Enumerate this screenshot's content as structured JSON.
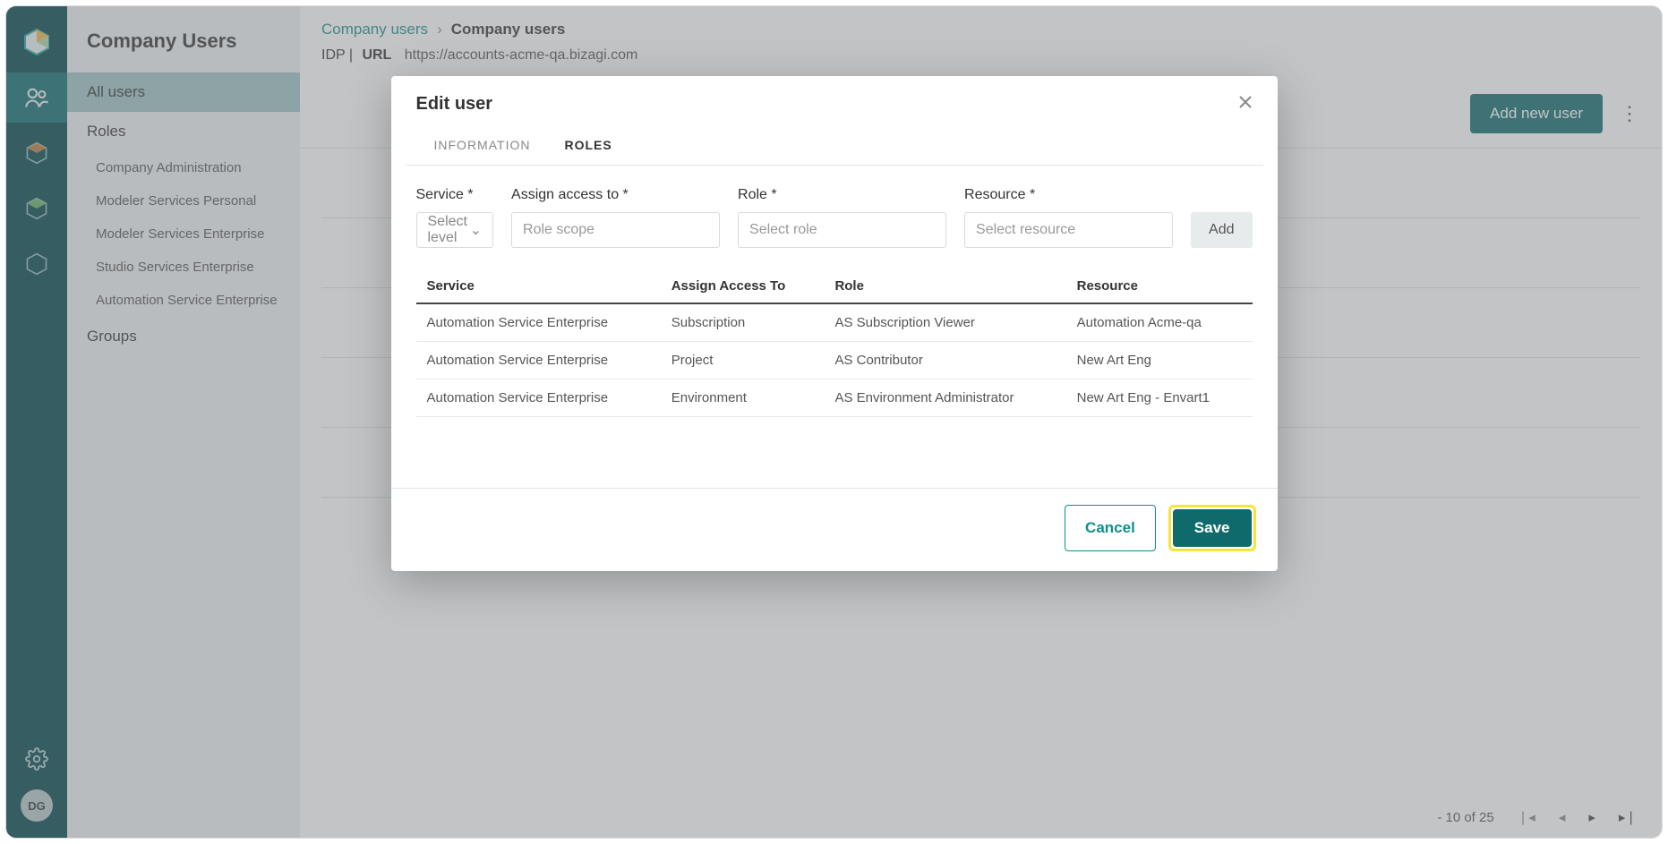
{
  "rail": {
    "avatar_initials": "DG"
  },
  "sidebar": {
    "title": "Company Users",
    "items": [
      {
        "label": "All users",
        "active": true
      },
      {
        "label": "Roles",
        "active": false
      }
    ],
    "role_children": [
      "Company Administration",
      "Modeler Services Personal",
      "Modeler Services Enterprise",
      "Studio Services Enterprise",
      "Automation Service Enterprise"
    ],
    "groups_label": "Groups"
  },
  "breadcrumb": {
    "link": "Company users",
    "current": "Company users"
  },
  "idp": {
    "prefix": "IDP |",
    "url_label": "URL",
    "url_value": "https://accounts-acme-qa.bizagi.com"
  },
  "toolbar": {
    "add_user": "Add new user"
  },
  "pager": {
    "range": "- 10 of 25"
  },
  "modal": {
    "title": "Edit user",
    "tabs": {
      "information": "Information",
      "roles": "Roles"
    },
    "filters": {
      "service_label": "Service *",
      "service_placeholder": "Select level",
      "assign_label": "Assign access to *",
      "assign_placeholder": "Role scope",
      "role_label": "Role *",
      "role_placeholder": "Select role",
      "resource_label": "Resource *",
      "resource_placeholder": "Select resource",
      "add_button": "Add"
    },
    "table": {
      "headers": {
        "service": "Service",
        "assign": "Assign Access To",
        "role": "Role",
        "resource": "Resource"
      },
      "rows": [
        {
          "service": "Automation Service Enterprise",
          "assign": "Subscription",
          "role": "AS Subscription Viewer",
          "resource": "Automation Acme-qa"
        },
        {
          "service": "Automation Service Enterprise",
          "assign": "Project",
          "role": "AS Contributor",
          "resource": "New Art Eng"
        },
        {
          "service": "Automation Service Enterprise",
          "assign": "Environment",
          "role": "AS Environment Administrator",
          "resource": "New Art Eng - Envart1"
        }
      ]
    },
    "footer": {
      "cancel": "Cancel",
      "save": "Save"
    }
  }
}
